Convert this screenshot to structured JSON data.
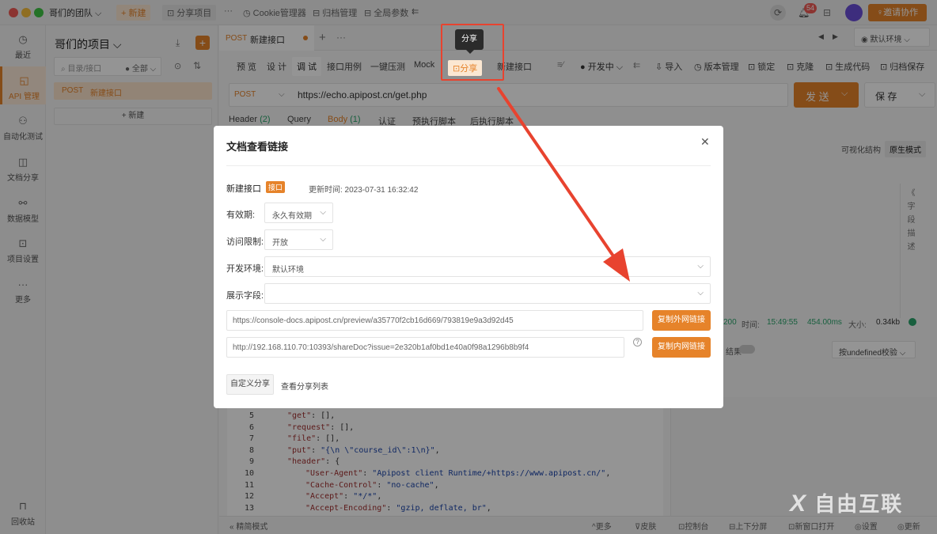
{
  "titlebar": {
    "team": "哥们的团队 ⌵",
    "new_btn": "+ 新建",
    "share_project": "⊡ 分享项目",
    "more": "···",
    "cookie": "◷ Cookie管理器",
    "archive": "⊟ 归档管理",
    "global_params": "⊟ 全局参数",
    "notif_count": "54",
    "invite": "♀邀请协作"
  },
  "leftnav": [
    {
      "icon": "◷",
      "label": "最近"
    },
    {
      "icon": "◱",
      "label": "API 管理"
    },
    {
      "icon": "⚇",
      "label": "自动化测试"
    },
    {
      "icon": "◫",
      "label": "文档分享"
    },
    {
      "icon": "⚯",
      "label": "数据模型"
    },
    {
      "icon": "⊡",
      "label": "项目设置"
    },
    {
      "icon": "···",
      "label": "更多"
    },
    {
      "icon": "⊓",
      "label": "回收站"
    }
  ],
  "project": {
    "title": "哥们的项目 ⌵",
    "search_placeholder": "目录/接口",
    "filter": "● 全部 ⌵",
    "tree_method": "POST",
    "tree_name": "新建接口",
    "new_label": "+ 新建"
  },
  "tab": {
    "method": "POST",
    "name": "新建接口"
  },
  "env": "◉ 默认环境 ⌵",
  "toolbar": {
    "preview": "预 览",
    "design": "设 计",
    "debug": "调 试",
    "cases": "接口用例",
    "stress": "一键压测",
    "mock": "Mock",
    "share": "⊡分享",
    "name": "新建接口",
    "status": "● 开发中 ⌵",
    "import": "⇩ 导入",
    "version": "◷ 版本管理",
    "lock": "⊡ 锁定",
    "clone": "⊡ 克隆",
    "gencode": "⊡ 生成代码",
    "archive_save": "⊡ 归档保存"
  },
  "tooltip": "分享",
  "request": {
    "method": "POST",
    "url": "https://echo.apipost.cn/get.php",
    "send": "发 送",
    "save": "保 存"
  },
  "subtabs": {
    "header": "Header",
    "header_count": "(2)",
    "query": "Query",
    "body": "Body",
    "body_count": "(1)",
    "auth": "认证",
    "pre": "预执行脚本",
    "post": "后执行脚本"
  },
  "view_modes": {
    "visual": "可视化结构",
    "raw": "原生模式"
  },
  "field_desc": [
    "《",
    "字",
    "段",
    "描",
    "述"
  ],
  "response": {
    "status": "200",
    "time_label": "时间:",
    "time": "15:49:55",
    "duration": "454.00ms",
    "size_label": "大小:",
    "size": "0.34kb",
    "result": "结果",
    "validate": "按undefined校验 ⌵"
  },
  "modal": {
    "title": "文档查看链接",
    "api_name": "新建接口",
    "api_badge": "接口",
    "updated": "更新时间: 2023-07-31 16:32:42",
    "validity_label": "有效期:",
    "validity": "永久有效期",
    "access_label": "访问限制:",
    "access": "开放",
    "env_label": "开发环境:",
    "env": "默认环境",
    "fields_label": "展示字段:",
    "external_url": "https://console-docs.apipost.cn/preview/a35770f2cb16d669/793819e9a3d92d45",
    "copy_external": "复制外网链接",
    "internal_url": "http://192.168.110.70:10393/shareDoc?issue=2e320b1af0bd1e40a0f98a1296b8b9f4",
    "copy_internal": "复制内网链接",
    "custom_share": "自定义分享",
    "share_list": "查看分享列表"
  },
  "code": [
    {
      "n": "5",
      "k": "\"get\"",
      "v": ": [],"
    },
    {
      "n": "6",
      "k": "\"request\"",
      "v": ": [],"
    },
    {
      "n": "7",
      "k": "\"file\"",
      "v": ": [],"
    },
    {
      "n": "8",
      "k": "\"put\"",
      "v": ": ",
      "s": "\"{\\n \\\"course_id\\\":1\\n}\"",
      "e": ","
    },
    {
      "n": "9",
      "k": "\"header\"",
      "v": ": {"
    },
    {
      "n": "10",
      "k": "\"User-Agent\"",
      "v": ": ",
      "s": "\"Apipost client Runtime/+https://www.apipost.cn/\"",
      "e": ","
    },
    {
      "n": "11",
      "k": "\"Cache-Control\"",
      "v": ": ",
      "s": "\"no-cache\"",
      "e": ","
    },
    {
      "n": "12",
      "k": "\"Accept\"",
      "v": ": ",
      "s": "\"*/*\"",
      "e": ","
    },
    {
      "n": "13",
      "k": "\"Accept-Encoding\"",
      "v": ": ",
      "s": "\"gzip, deflate, br\"",
      "e": ","
    }
  ],
  "bottombar": {
    "simple": "« 精简模式",
    "more": "^更多",
    "skin": "⊽皮肤",
    "console": "⊡控制台",
    "split": "⊟上下分屏",
    "new_window": "⊡新窗口打开",
    "settings": "◎设置",
    "update": "◎更新"
  },
  "watermark": "自由互联"
}
